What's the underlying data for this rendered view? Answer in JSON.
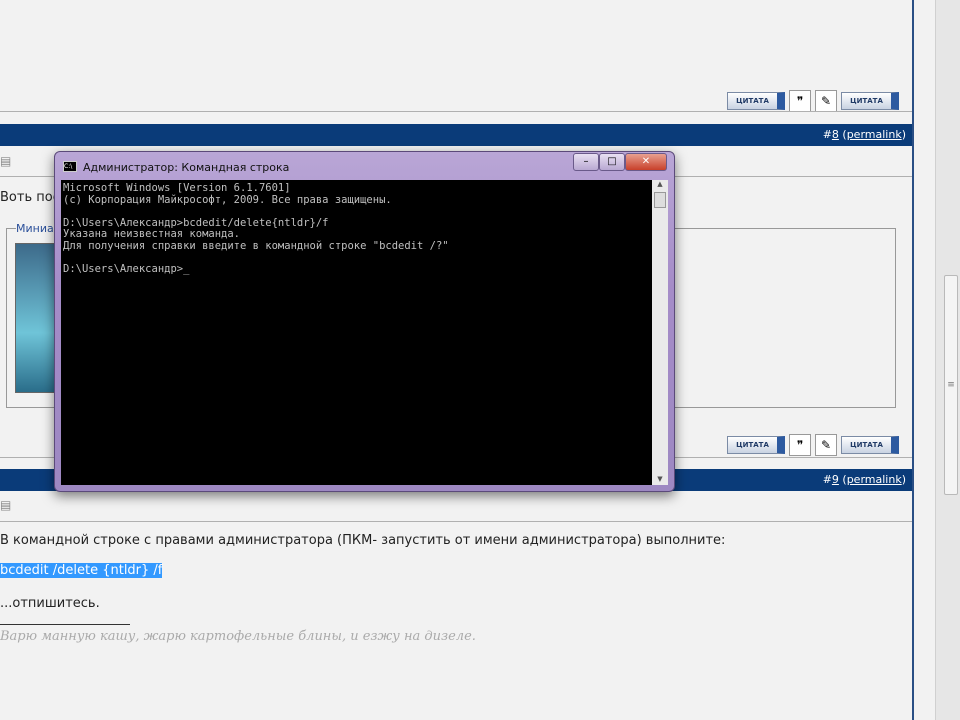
{
  "posts": [
    {
      "number": "8",
      "number_prefix": "#",
      "permalink": "permalink"
    },
    {
      "number": "9",
      "number_prefix": "#",
      "permalink": "permalink"
    }
  ],
  "quote_label": "ЦИТАТА",
  "post8": {
    "text_partial": "Воть пос",
    "thumb_label": "Миниат"
  },
  "post9": {
    "line1": "В командной строке с правами администратора (ПКМ- запустить от имени администратора) выполните:",
    "command": "bcdedit /delete {ntldr} /f",
    "line3": "...отпишитесь.",
    "signature": "Варю манную кашу, жарю картофельные блины, и езжу на дизеле."
  },
  "cmd": {
    "title": "Администратор: Командная строка",
    "lines": [
      "Microsoft Windows [Version 6.1.7601]",
      "(c) Корпорация Майкрософт, 2009. Все права защищены.",
      "",
      "D:\\Users\\Александр>bcdedit/delete{ntldr}/f",
      "Указана неизвестная команда.",
      "Для получения справки введите в командной строке \"bcdedit /?\"",
      "",
      "D:\\Users\\Александр>_"
    ]
  },
  "colors": {
    "header": "#0a3b79",
    "selection": "#3399ff"
  }
}
